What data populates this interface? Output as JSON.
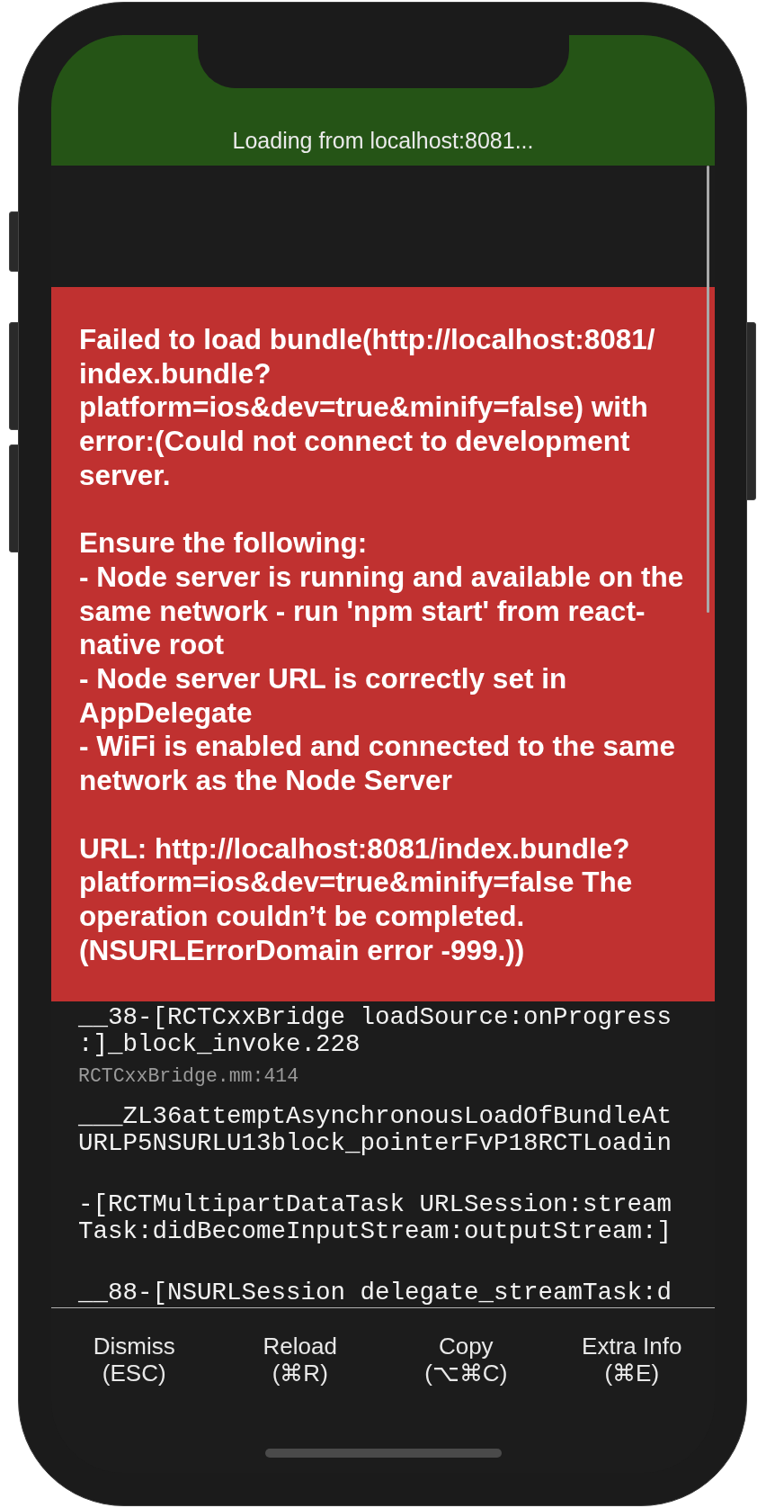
{
  "status_banner": {
    "text": "Loading from localhost:8081..."
  },
  "error_message": {
    "paragraphs": [
      {
        "lines": [
          "Failed to load bundle(http://localhost:8081/",
          "index.bundle?",
          "platform=ios&dev=true&minify=false) with",
          "error:(Could not connect to development",
          "server."
        ]
      },
      {
        "lines": [
          "Ensure the following:",
          "- Node server is running and available on the",
          "same network - run 'npm start' from react-",
          "native root",
          "- Node server URL is correctly set in",
          "AppDelegate",
          "- WiFi is enabled and connected to the same",
          "network as the Node Server"
        ]
      },
      {
        "lines": [
          "URL: http://localhost:8081/index.bundle?",
          "platform=ios&dev=true&minify=false The",
          "operation couldn’t be completed.",
          "(NSURLErrorDomain error -999.))"
        ]
      }
    ]
  },
  "stack_frames": [
    {
      "method_lines": [
        "__38-[RCTCxxBridge loadSource:onProgress",
        ":]_block_invoke.228"
      ],
      "location": "RCTCxxBridge.mm:414"
    },
    {
      "method_lines": [
        "___ZL36attemptAsynchronousLoadOfBundleAt",
        "URLP5NSURLU13block_pointerFvP18RCTLoadin"
      ]
    },
    {
      "method_lines": [
        "-[RCTMultipartDataTask URLSession:stream",
        "Task:didBecomeInputStream:outputStream:]"
      ]
    },
    {
      "method_lines": [
        "__88-[NSURLSession delegate_streamTask:d"
      ]
    }
  ],
  "buttons": [
    {
      "label": "Dismiss",
      "shortcut": "(ESC)"
    },
    {
      "label": "Reload",
      "shortcut": "(⌘R)"
    },
    {
      "label": "Copy",
      "shortcut": "(⌥⌘C)"
    },
    {
      "label": "Extra Info",
      "shortcut": "(⌘E)"
    }
  ]
}
